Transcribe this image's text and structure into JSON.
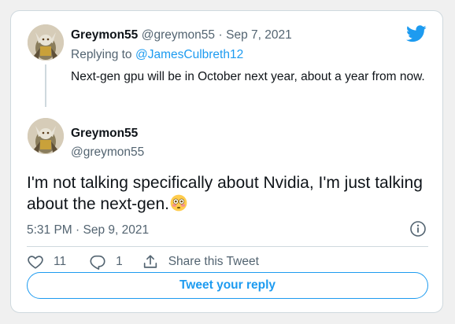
{
  "colors": {
    "accent": "#1d9bf0",
    "muted_text": "#536471",
    "border": "#cfd9de",
    "background": "#f0f0f0"
  },
  "parent_tweet": {
    "author_name": "Greymon55",
    "author_handle": "@greymon55",
    "separator": "·",
    "date": "Sep 7, 2021",
    "replying_to_prefix": "Replying to",
    "replying_to_handle": "@JamesCulbreth12",
    "text": "Next-gen gpu will be in October next year, about a year from now."
  },
  "main_tweet": {
    "author_name": "Greymon55",
    "author_handle": "@greymon55",
    "text": "I'm not talking specifically about Nvidia, I'm just talking about the next-gen.",
    "emoji": "flushed-face-emoji",
    "timestamp": "5:31 PM · Sep 9, 2021"
  },
  "actions": {
    "like_count": "11",
    "reply_count": "1",
    "share_label": "Share this Tweet"
  },
  "reply_button_label": "Tweet your reply",
  "icons": {
    "logo": "twitter-bird-icon",
    "info": "info-icon",
    "like": "heart-icon",
    "reply": "speech-bubble-icon",
    "share": "share-icon"
  }
}
